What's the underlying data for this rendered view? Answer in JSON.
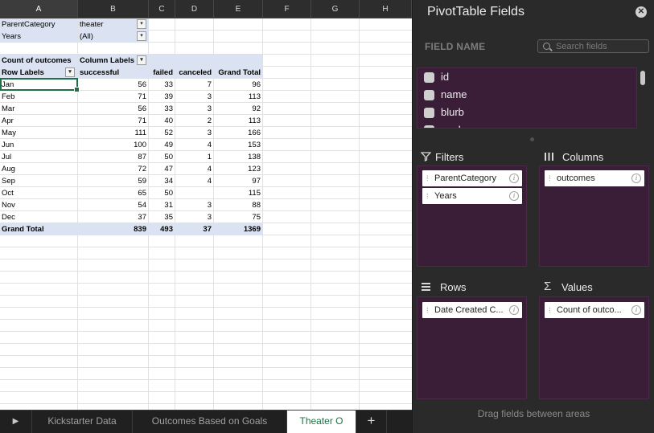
{
  "columns": [
    "A",
    "B",
    "C",
    "D",
    "E",
    "F",
    "G",
    "H"
  ],
  "filters": [
    {
      "label": "ParentCategory",
      "value": "theater"
    },
    {
      "label": "Years",
      "value": "(All)"
    }
  ],
  "pivot": {
    "corner_label": "Count of outcomes",
    "column_labels": "Column Labels",
    "row_labels": "Row Labels",
    "headers": [
      "successful",
      "failed",
      "canceled",
      "Grand Total"
    ],
    "rows": [
      {
        "label": "Jan",
        "values": [
          "56",
          "33",
          "7",
          "96"
        ]
      },
      {
        "label": "Feb",
        "values": [
          "71",
          "39",
          "3",
          "113"
        ]
      },
      {
        "label": "Mar",
        "values": [
          "56",
          "33",
          "3",
          "92"
        ]
      },
      {
        "label": "Apr",
        "values": [
          "71",
          "40",
          "2",
          "113"
        ]
      },
      {
        "label": "May",
        "values": [
          "111",
          "52",
          "3",
          "166"
        ]
      },
      {
        "label": "Jun",
        "values": [
          "100",
          "49",
          "4",
          "153"
        ]
      },
      {
        "label": "Jul",
        "values": [
          "87",
          "50",
          "1",
          "138"
        ]
      },
      {
        "label": "Aug",
        "values": [
          "72",
          "47",
          "4",
          "123"
        ]
      },
      {
        "label": "Sep",
        "values": [
          "59",
          "34",
          "4",
          "97"
        ]
      },
      {
        "label": "Oct",
        "values": [
          "65",
          "50",
          "",
          "115"
        ]
      },
      {
        "label": "Nov",
        "values": [
          "54",
          "31",
          "3",
          "88"
        ]
      },
      {
        "label": "Dec",
        "values": [
          "37",
          "35",
          "3",
          "75"
        ]
      }
    ],
    "total": {
      "label": "Grand Total",
      "values": [
        "839",
        "493",
        "37",
        "1369"
      ]
    }
  },
  "tabs": {
    "items": [
      "Kickstarter Data",
      "Outcomes Based on Goals",
      "Theater O"
    ],
    "active_index": 2,
    "add_label": "+",
    "scroll_icon": "play-right-icon"
  },
  "panel": {
    "title": "PivotTable Fields",
    "field_name_label": "FIELD NAME",
    "search_placeholder": "Search fields",
    "fields": [
      "id",
      "name",
      "blurb",
      "goal"
    ],
    "areas": {
      "filters": {
        "label": "Filters",
        "icon": "funnel-icon",
        "items": [
          "ParentCategory",
          "Years"
        ]
      },
      "columns": {
        "label": "Columns",
        "icon": "columns-icon",
        "items": [
          "outcomes"
        ]
      },
      "rows": {
        "label": "Rows",
        "icon": "rows-icon",
        "items": [
          "Date Created C..."
        ]
      },
      "values": {
        "label": "Values",
        "icon": "sigma-icon",
        "items": [
          "Count of outco..."
        ]
      }
    },
    "drag_hint": "Drag fields between areas"
  },
  "colors": {
    "accent_green": "#1e7145",
    "pivot_header_blue": "#dbe3f2",
    "panel_area_purple": "#3a1e37"
  }
}
